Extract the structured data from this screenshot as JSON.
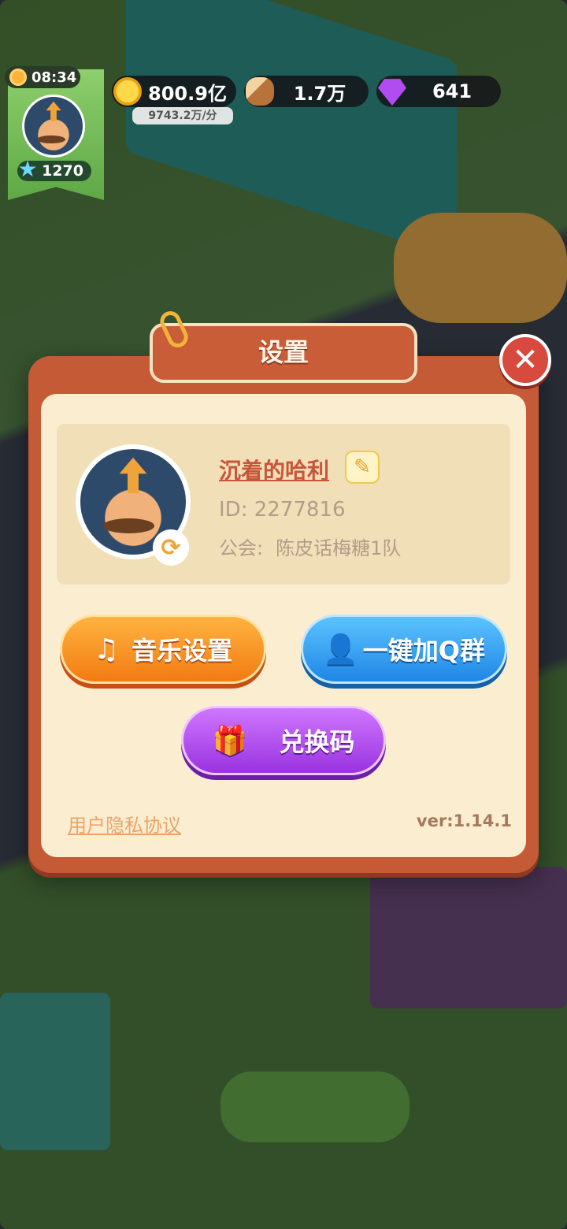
{
  "hud": {
    "clock": "08:34",
    "level": "1270",
    "resources": {
      "coins": "800.9亿",
      "coin_rate": "9743.2万/分",
      "wood": "1.7万",
      "gems": "641"
    }
  },
  "dialog": {
    "title": "设置",
    "close_symbol": "✕",
    "profile": {
      "nickname": "沉着的哈利",
      "id": "ID: 2277816",
      "guild_label": "公会:",
      "guild_name": "陈皮话梅糖1队"
    },
    "buttons": {
      "music": "音乐设置",
      "join_qq": "一键加Q群",
      "redeem": "兑换码"
    },
    "privacy_link": "用户隐私协议",
    "version": "ver:1.14.1"
  },
  "icons": {
    "music": "music-note-icon",
    "user": "user-icon",
    "gift": "gift-icon",
    "edit": "pencil-icon",
    "refresh": "refresh-icon"
  },
  "colors": {
    "dialog_frame": "#c55a37",
    "dialog_body": "#fbeed0",
    "music_button": "#f27b12",
    "qq_button": "#1f86e6",
    "redeem_button": "#9a33e0",
    "nickname": "#c8553a"
  }
}
